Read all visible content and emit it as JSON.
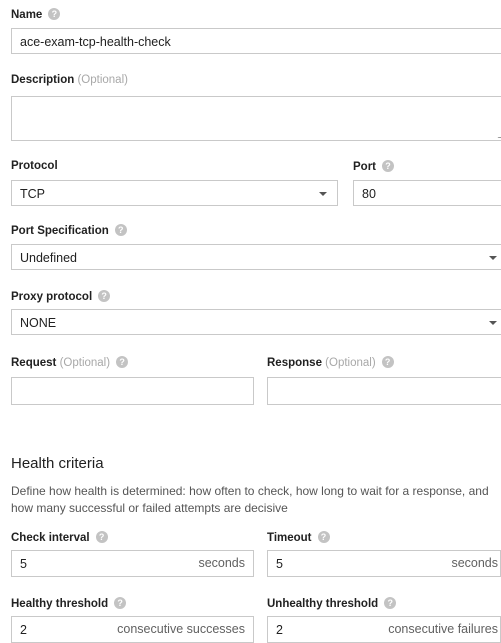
{
  "name": {
    "label": "Name",
    "value": "ace-exam-tcp-health-check"
  },
  "description": {
    "label": "Description",
    "optional": "(Optional)",
    "value": ""
  },
  "protocol": {
    "label": "Protocol",
    "value": "TCP"
  },
  "port": {
    "label": "Port",
    "value": "80"
  },
  "port_specification": {
    "label": "Port Specification",
    "value": "Undefined"
  },
  "proxy_protocol": {
    "label": "Proxy protocol",
    "value": "NONE"
  },
  "request": {
    "label": "Request",
    "optional": "(Optional)",
    "value": ""
  },
  "response": {
    "label": "Response",
    "optional": "(Optional)",
    "value": ""
  },
  "health_criteria": {
    "title": "Health criteria",
    "description": "Define how health is determined: how often to check, how long to wait for a response, and how many successful or failed attempts are decisive",
    "check_interval": {
      "label": "Check interval",
      "value": "5",
      "unit": "seconds"
    },
    "timeout": {
      "label": "Timeout",
      "value": "5",
      "unit": "seconds"
    },
    "healthy_threshold": {
      "label": "Healthy threshold",
      "value": "2",
      "unit": "consecutive successes"
    },
    "unhealthy_threshold": {
      "label": "Unhealthy threshold",
      "value": "2",
      "unit": "consecutive failures"
    }
  },
  "icons": {
    "help": "help-icon",
    "dropdown": "dropdown-arrow-icon"
  },
  "colors": {
    "border": "#c9c9c9",
    "help_icon": "#c3c3c3",
    "optional_text": "#a8a8a8"
  }
}
